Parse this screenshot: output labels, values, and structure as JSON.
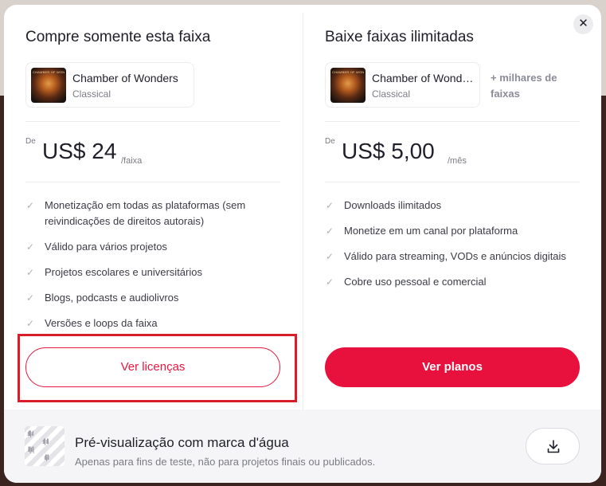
{
  "modal": {
    "close_glyph": "✕"
  },
  "left": {
    "title": "Compre somente esta faixa",
    "track": {
      "name": "Chamber of Wonders",
      "genre": "Classical",
      "cover_text": "CHAMBER OF WONDERS"
    },
    "price_from": "De",
    "price": "US$ 24",
    "price_unit": "/faixa",
    "features": [
      "Monetização em todas as plataformas (sem reivindicações de direitos autorais)",
      "Válido para vários projetos",
      "Projetos escolares e universitários",
      "Blogs, podcasts e audiolivros",
      "Versões e loops da faixa"
    ],
    "button": "Ver licenças"
  },
  "right": {
    "title": "Baixe faixas ilimitadas",
    "track": {
      "name": "Chamber of Wonders",
      "genre": "Classical",
      "cover_text": "CHAMBER OF WONDERS"
    },
    "more_tracks": "+ milhares de faixas",
    "price_from": "De",
    "price": "US$ 5,00",
    "price_unit": "/mês",
    "features": [
      "Downloads ilimitados",
      "Monetize em um canal por plataforma",
      "Válido para streaming, VODs e anúncios digitais",
      "Cobre uso pessoal e comercial"
    ],
    "button": "Ver planos"
  },
  "footer": {
    "title": "Pré-visualização com marca d'água",
    "subtitle": "Apenas para fins de teste, não para projetos finais ou publicados."
  },
  "colors": {
    "accent": "#e8103c",
    "highlight": "#d81e2a"
  },
  "icons": {
    "check": "check-icon",
    "close": "close-icon",
    "download": "download-icon"
  }
}
